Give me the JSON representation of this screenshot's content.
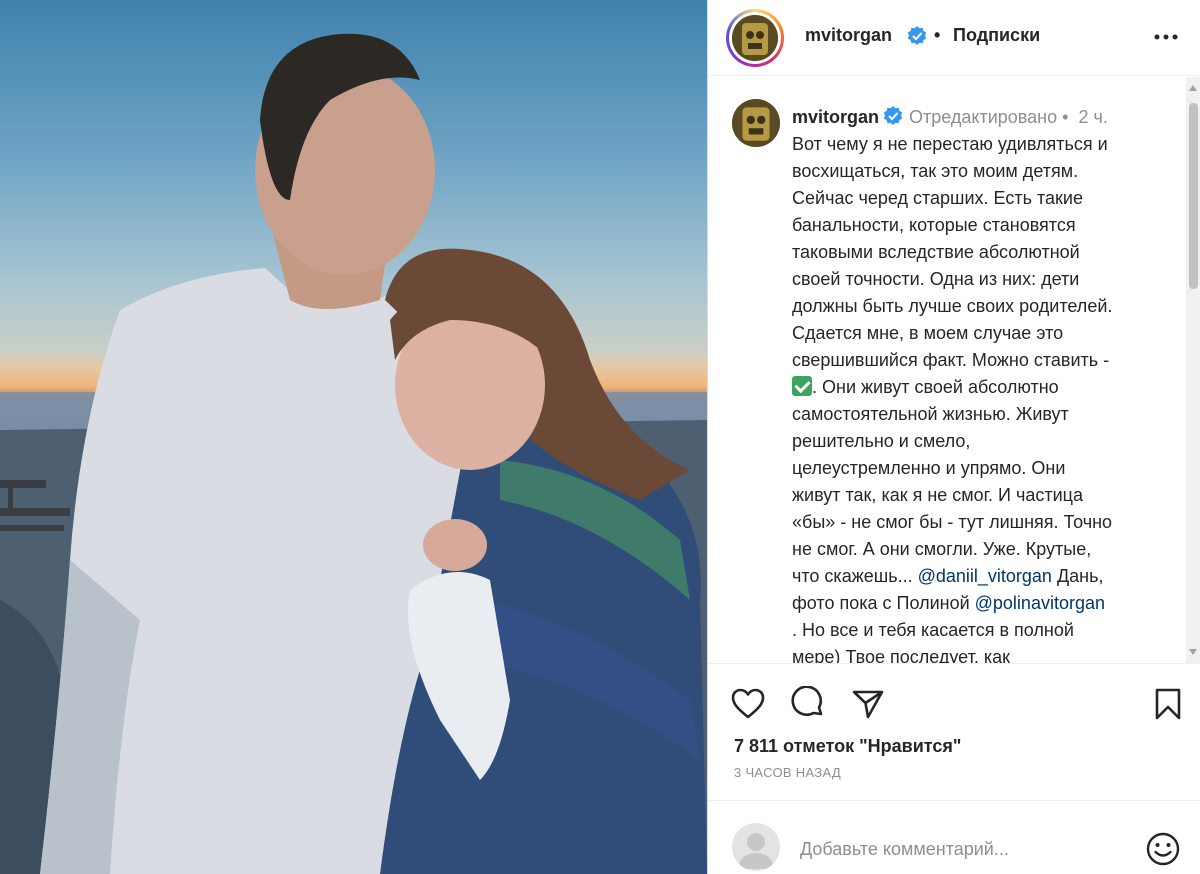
{
  "post": {
    "image": {
      "subject": "photo-of-man-and-girl-on-beach"
    },
    "header": {
      "username": "mvitorgan",
      "separator": "•",
      "follow_label": "Подписки",
      "more_icon": "more-horizontal-icon"
    },
    "caption": {
      "username": "mvitorgan",
      "edited_label": "Отредактировано •",
      "time_ago": "2 ч.",
      "lines": [
        "Вот чему я не перестаю удивляться и",
        "восхищаться, так это моим детям.",
        "Сейчас черед старших. Есть такие",
        "банальности, которые становятся",
        "таковыми вследствие абсолютной",
        "своей точности. Одна из них: дети",
        "должны быть лучше своих родителей.",
        "Сдается мне, в моем случае это",
        "свершившийся факт. Можно ставить -"
      ],
      "line_check_suffix": ". Они живут своей абсолютно",
      "lines_after": [
        "самостоятельной жизнью. Живут",
        "решительно и смело,",
        "целеустремленно и упрямо. Они",
        "живут так, как я не смог. И частица",
        "«бы» - не смог бы - тут лишняя. Точно",
        "не смог. А они смогли. Уже. Крутые,"
      ],
      "mention_line_1_prefix": "что скажешь... ",
      "mention_1": "@daniil_vitorgan",
      "mention_line_1_suffix": " Дань,",
      "mention_line_2_prefix": "фото пока с Полиной ",
      "mention_2": "@polinavitorgan",
      "final_lines": [
        ". Но все и тебя касается в полной",
        "мере) Твое последует, как"
      ]
    },
    "actions": {
      "like_icon": "heart-icon",
      "comment_icon": "comment-icon",
      "share_icon": "send-icon",
      "save_icon": "bookmark-icon"
    },
    "likes_text": "7 811 отметок \"Нравится\"",
    "timestamp": "3 ЧАСОВ НАЗАД",
    "comment": {
      "placeholder": "Добавьте комментарий...",
      "emoji_icon": "smile-icon"
    },
    "colors": {
      "verified": "#3897f0",
      "mention": "#00376b",
      "check_emoji": "#3ba55d"
    }
  }
}
